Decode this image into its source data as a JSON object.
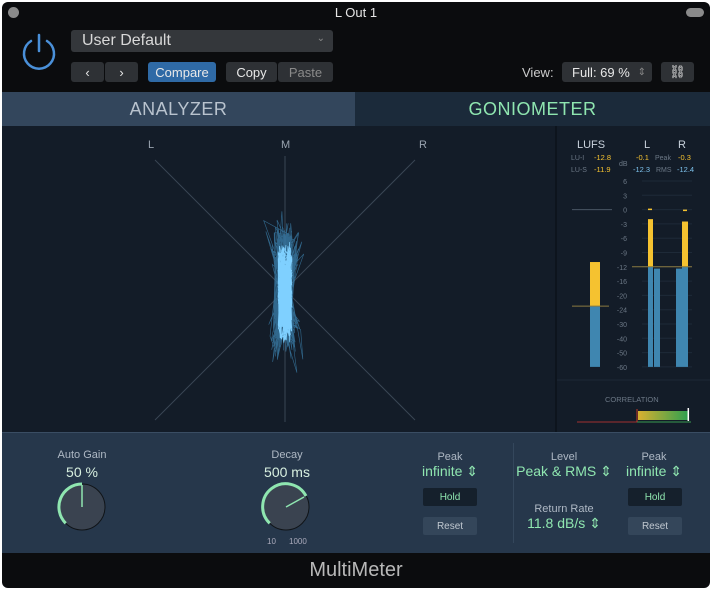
{
  "window": {
    "title": "L Out 1"
  },
  "header": {
    "preset": "User Default",
    "prev_icon": "chevron-left",
    "next_icon": "chevron-right",
    "compare": "Compare",
    "copy": "Copy",
    "paste": "Paste",
    "view_label": "View:",
    "view_value": "Full: 69 %",
    "link_icon": "link-icon"
  },
  "tabs": [
    {
      "label": "ANALYZER",
      "active": false
    },
    {
      "label": "GONIOMETER",
      "active": true
    }
  ],
  "goniometer": {
    "labels": [
      "L",
      "M",
      "R"
    ]
  },
  "meters": {
    "lufs_label": "LUFS",
    "l_label": "L",
    "r_label": "R",
    "lu_i_label": "LU-I",
    "lu_i": "-12.8",
    "lu_s_label": "LU-S",
    "lu_s": "-11.9",
    "db_label": "dB",
    "peak_label": "Peak",
    "rms_label": "RMS",
    "l_peak": "-0.1",
    "r_peak": "-0.3",
    "l_rms": "-12.3",
    "r_rms": "-12.4",
    "scale": [
      "6",
      "3",
      "0",
      "-3",
      "-6",
      "-9",
      "-12",
      "-16",
      "-20",
      "-24",
      "-30",
      "-40",
      "-50",
      "-60"
    ],
    "lufs_level": -11,
    "lufs_target": -23,
    "l_peak_level": -2,
    "l_rms_level": -12.5,
    "r_peak_level": -2.5,
    "r_rms_level": -12.5,
    "rms_ref": -12,
    "correlation_label": "CORRELATION",
    "correlation": 0.95,
    "colors": {
      "peak": "#f5c230",
      "rms": "#3f86b0",
      "accent": "#8fe6b0"
    }
  },
  "controls": {
    "auto_gain_label": "Auto Gain",
    "auto_gain": "50 %",
    "auto_gain_value": 50,
    "decay_label": "Decay",
    "decay": "500 ms",
    "decay_min": "10",
    "decay_max": "1000",
    "peak_label": "Peak",
    "peak": "infinite",
    "hold": "Hold",
    "reset": "Reset",
    "level_label": "Level",
    "level": "Peak & RMS",
    "return_label": "Return Rate",
    "return_rate": "11.8 dB/s",
    "peak2_label": "Peak",
    "peak2": "infinite",
    "hold2": "Hold",
    "reset2": "Reset"
  },
  "footer": {
    "name": "MultiMeter"
  }
}
